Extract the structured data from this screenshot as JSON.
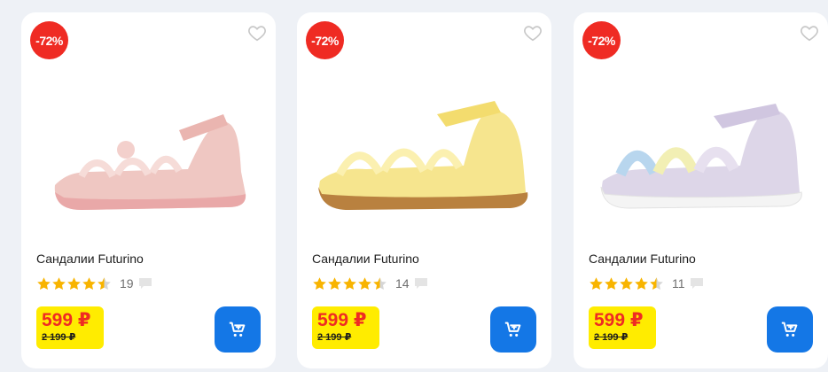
{
  "products": [
    {
      "discount": "-72%",
      "title": "Сандалии Futurino",
      "rating": 4.5,
      "reviews": "19",
      "price": "599 ₽",
      "old_price": "2 199 ₽",
      "color": "pink"
    },
    {
      "discount": "-72%",
      "title": "Сандалии Futurino",
      "rating": 4.5,
      "reviews": "14",
      "price": "599 ₽",
      "old_price": "2 199 ₽",
      "color": "yellow"
    },
    {
      "discount": "-72%",
      "title": "Сандалии Futurino",
      "rating": 4.5,
      "reviews": "11",
      "price": "599 ₽",
      "old_price": "2 199 ₽",
      "color": "lavender"
    }
  ],
  "icons": {
    "favorite": "heart-outline-icon",
    "star": "star-icon",
    "comment": "speech-bubble-icon",
    "cart": "cart-plus-icon"
  },
  "colors": {
    "badge": "#ef2b23",
    "price_bg": "#ffec00",
    "price_text": "#ef2b23",
    "cart_button": "#1477e6",
    "star": "#f8b400"
  }
}
